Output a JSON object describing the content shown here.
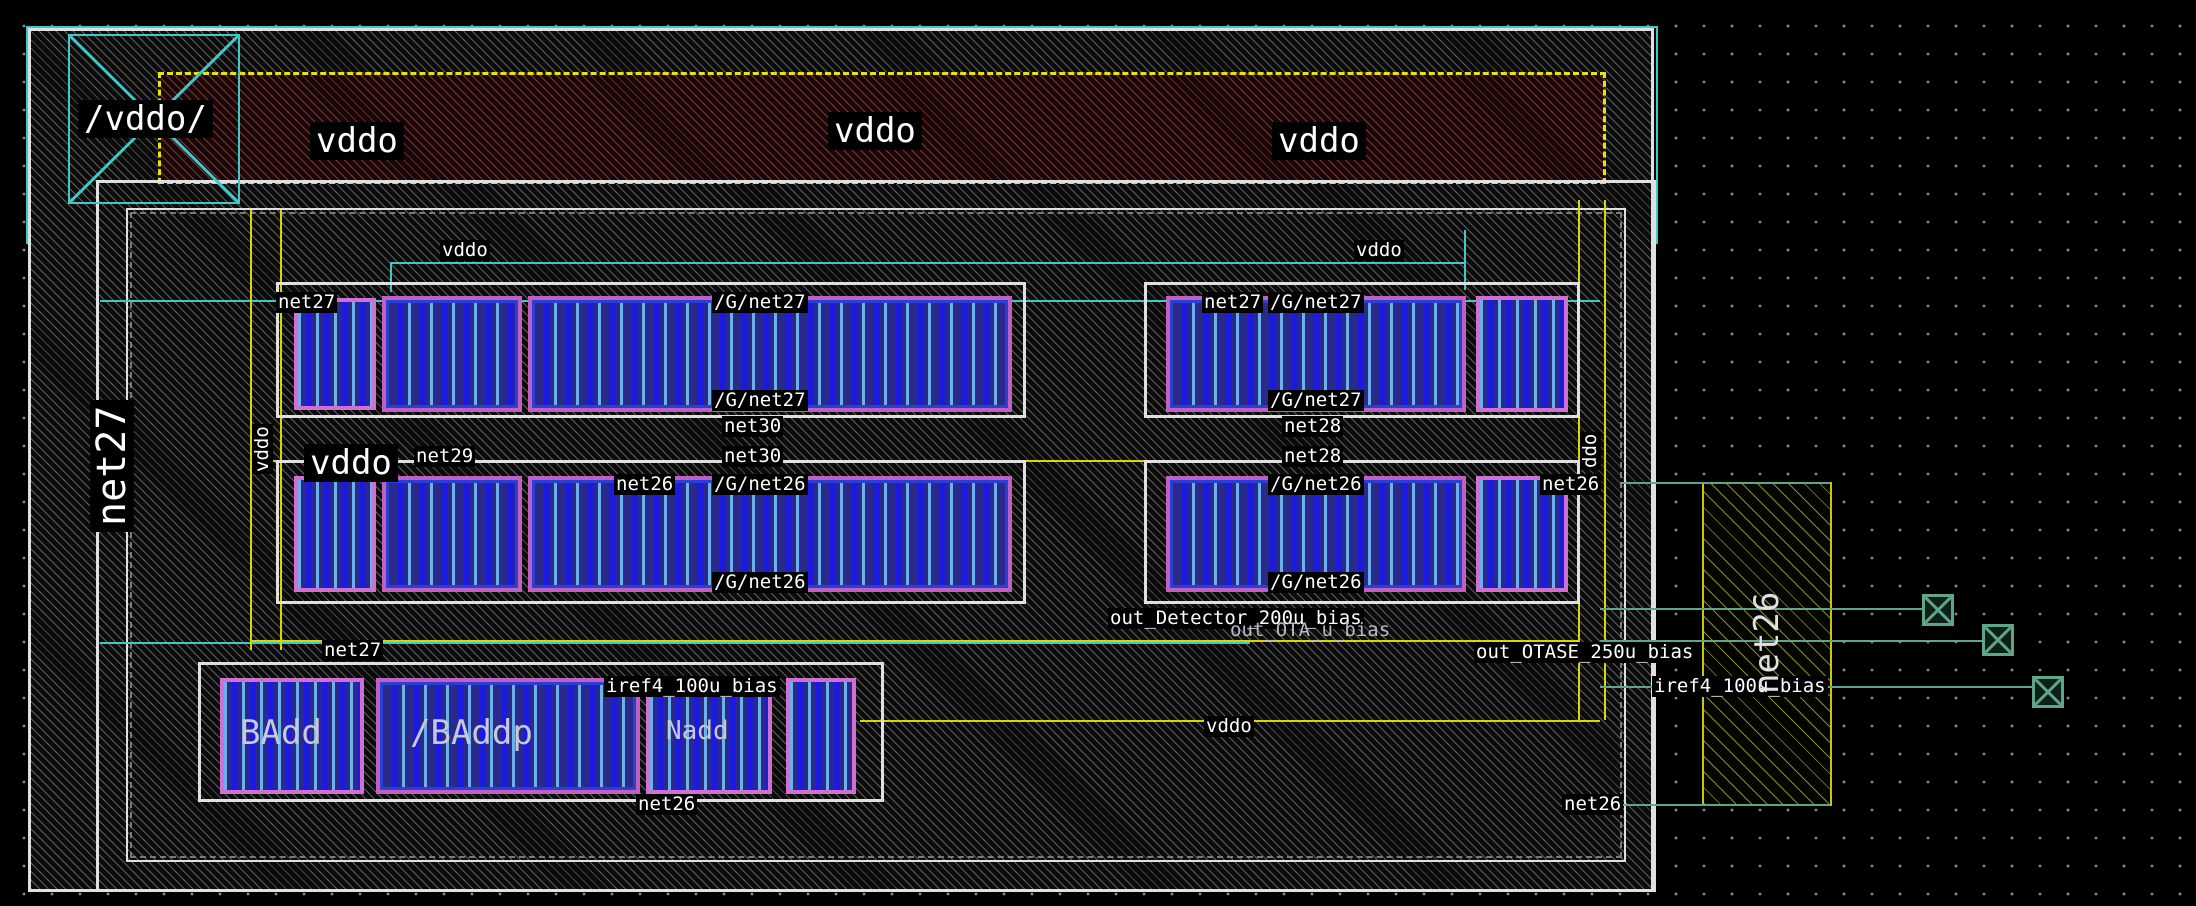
{
  "layout_view": {
    "block_label": "net27",
    "supply_labels": {
      "top_left": "vddo",
      "top_mid": "vddo",
      "top_right": "vddo",
      "pin_corner": "/vddo/",
      "row1_left": "vddo",
      "row1_right": "vddo",
      "left_vertical": "vddo",
      "row2_big": "vddo",
      "right_vertical": "ddo",
      "bottom": "vddo"
    },
    "net_labels": {
      "net27_top_left": "net27",
      "net27_right": "net27",
      "g_net27_top_left": "/G/net27",
      "g_net27_top_right": "/G/net27",
      "g_net27_mid_left": "/G/net27",
      "g_net27_mid_right": "/G/net27",
      "net30_a": "net30",
      "net30_b": "net30",
      "net28_a": "net28",
      "net28_b": "net28",
      "net29": "net29",
      "net26_left": "net26",
      "g_net26_top_left": "/G/net26",
      "g_net26_bottom_left": "/G/net26",
      "g_net26_top_right": "/G/net26",
      "g_net26_bottom_right": "/G/net26",
      "net26_right": "net26",
      "net27_bottom": "net27",
      "iref4_left": "iref4_100u_bias",
      "net26_bottom": "net26",
      "out_detector": "out_Detector_200u_bias",
      "out_otase": "out_OTASE_250u_bias",
      "iref4_right": "iref4_100u_bias",
      "net26_far": "net26",
      "resistor": "net26"
    },
    "ghost_labels": {
      "dev_row3_a": "BAdd",
      "dev_row3_b": "/BAddp",
      "dev_row3_c": "Nadd",
      "out_ghost": "out_OTA_u_bias"
    },
    "pins": [
      "pin-out-detector",
      "pin-out-otase",
      "pin-iref4"
    ],
    "colors": {
      "background": "#000000",
      "outline": "#e0e0e0",
      "cyan": "#3fc8c8",
      "yellow": "#e6e600",
      "device_fill": "#2a2a8a",
      "device_border": "#c060c0",
      "pin": "#5fa58a"
    }
  }
}
